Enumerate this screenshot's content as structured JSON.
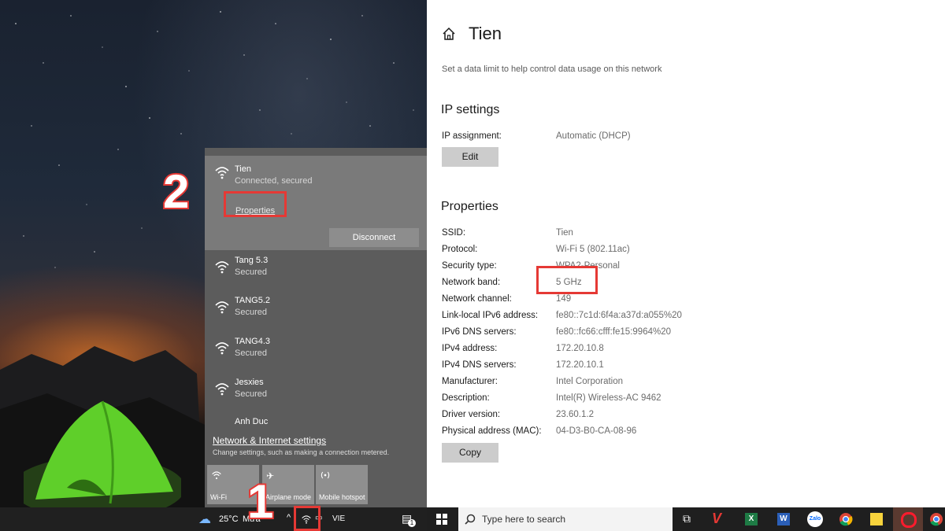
{
  "flyout": {
    "connected": {
      "name": "Tien",
      "status": "Connected, secured",
      "properties_label": "Properties",
      "disconnect_label": "Disconnect"
    },
    "networks": [
      {
        "name": "Tang 5.3",
        "status": "Secured"
      },
      {
        "name": "TANG5.2",
        "status": "Secured"
      },
      {
        "name": "TANG4.3",
        "status": "Secured"
      },
      {
        "name": "Jesxies",
        "status": "Secured"
      },
      {
        "name": "Anh Duc",
        "status": ""
      }
    ],
    "settings_link": "Network & Internet settings",
    "settings_desc": "Change settings, such as making a connection metered.",
    "tiles": [
      {
        "label": "Wi-Fi",
        "icon": "wifi-icon"
      },
      {
        "label": "Airplane mode",
        "icon": "airplane-icon"
      },
      {
        "label": "Mobile hotspot",
        "icon": "hotspot-icon"
      }
    ]
  },
  "annotations": {
    "step1": "1",
    "step2": "2"
  },
  "left_taskbar": {
    "weather": "25°C",
    "weather_desc": "Mưa",
    "language": "VIE",
    "notification_count": "1"
  },
  "settings": {
    "title": "Tien",
    "data_limit_text": "Set a data limit to help control data usage on this network",
    "ip_settings": {
      "heading": "IP settings",
      "assignment_label": "IP assignment:",
      "assignment_value": "Automatic (DHCP)",
      "edit_label": "Edit"
    },
    "properties": {
      "heading": "Properties",
      "rows": [
        {
          "label": "SSID:",
          "value": "Tien"
        },
        {
          "label": "Protocol:",
          "value": "Wi-Fi 5 (802.11ac)"
        },
        {
          "label": "Security type:",
          "value": "WPA2-Personal"
        },
        {
          "label": "Network band:",
          "value": "5 GHz"
        },
        {
          "label": "Network channel:",
          "value": "149"
        },
        {
          "label": "Link-local IPv6 address:",
          "value": "fe80::7c1d:6f4a:a37d:a055%20"
        },
        {
          "label": "IPv6 DNS servers:",
          "value": "fe80::fc66:cfff:fe15:9964%20"
        },
        {
          "label": "IPv4 address:",
          "value": "172.20.10.8"
        },
        {
          "label": "IPv4 DNS servers:",
          "value": "172.20.10.1"
        },
        {
          "label": "Manufacturer:",
          "value": "Intel Corporation"
        },
        {
          "label": "Description:",
          "value": "Intel(R) Wireless-AC 9462"
        },
        {
          "label": "Driver version:",
          "value": "23.60.1.2"
        },
        {
          "label": "Physical address (MAC):",
          "value": "04-D3-B0-CA-08-96"
        }
      ],
      "copy_label": "Copy"
    }
  },
  "right_taskbar": {
    "search_placeholder": "Type here to search",
    "apps": [
      "task-view-icon",
      "vietcombank-icon",
      "excel-icon",
      "word-icon",
      "zalo-icon",
      "chrome-icon",
      "sticky-notes-icon",
      "opera-icon",
      "chrome-profile-icon"
    ],
    "zalo_label": "Zalo"
  },
  "colors": {
    "highlight": "#e53935",
    "flyout_bg": "#5c5c5c",
    "connected_bg": "#7a7a7a"
  }
}
